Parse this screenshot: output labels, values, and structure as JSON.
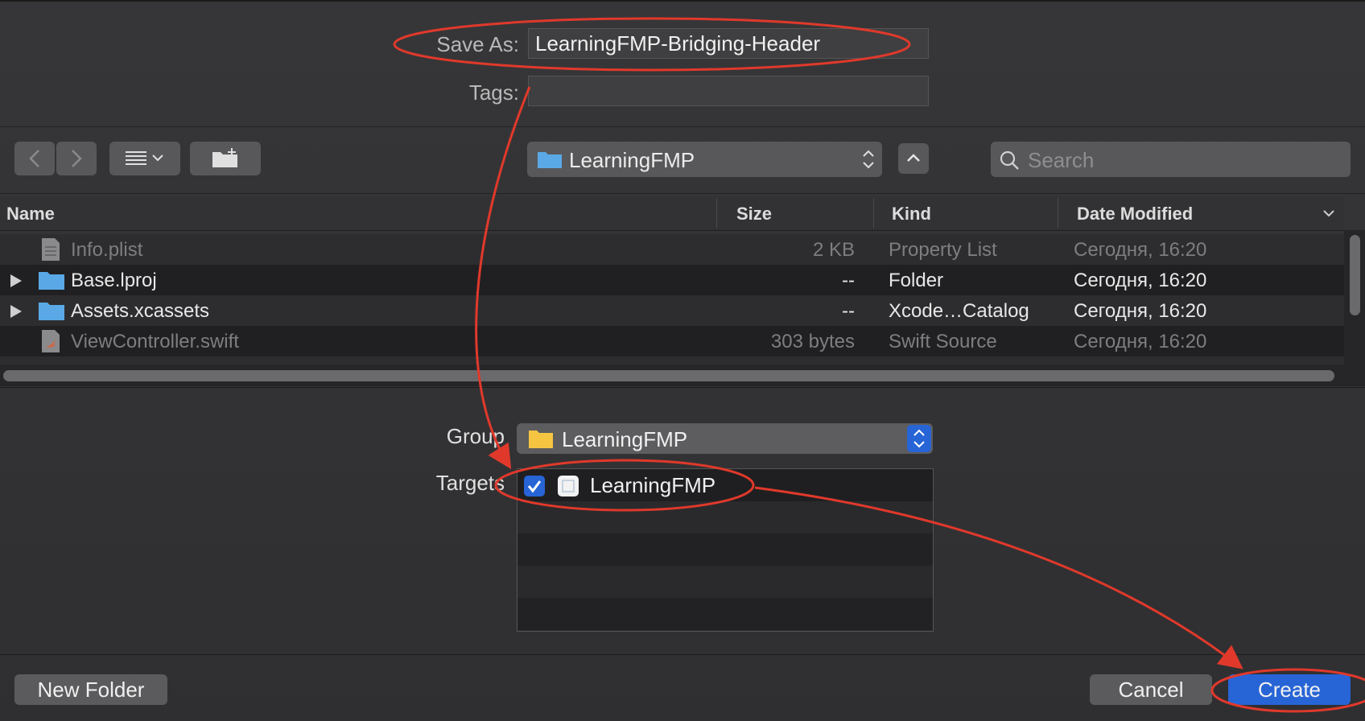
{
  "save_as": {
    "label": "Save As:",
    "value": "LearningFMP-Bridging-Header"
  },
  "tags": {
    "label": "Tags:",
    "value": ""
  },
  "toolbar": {
    "back_icon": "chevron-left-icon",
    "forward_icon": "chevron-right-icon",
    "view_icon": "list-view-icon",
    "new_folder_icon": "new-folder-icon",
    "location": "LearningFMP",
    "search_placeholder": "Search"
  },
  "file_list": {
    "columns": [
      "Name",
      "Size",
      "Kind",
      "Date Modified"
    ],
    "rows": [
      {
        "name": "Info.plist",
        "size": "2 KB",
        "kind": "Property List",
        "date": "Сегодня, 16:20",
        "icon": "plist-file-icon",
        "enabled": false,
        "expandable": false
      },
      {
        "name": "Base.lproj",
        "size": "--",
        "kind": "Folder",
        "date": "Сегодня, 16:20",
        "icon": "folder-icon",
        "enabled": true,
        "expandable": true
      },
      {
        "name": "Assets.xcassets",
        "size": "--",
        "kind": "Xcode…Catalog",
        "date": "Сегодня, 16:20",
        "icon": "folder-icon",
        "enabled": true,
        "expandable": true
      },
      {
        "name": "ViewController.swift",
        "size": "303 bytes",
        "kind": "Swift Source",
        "date": "Сегодня, 16:20",
        "icon": "swift-file-icon",
        "enabled": false,
        "expandable": false
      }
    ]
  },
  "group": {
    "label": "Group",
    "value": "LearningFMP"
  },
  "targets": {
    "label": "Targets",
    "items": [
      {
        "name": "LearningFMP",
        "checked": true
      }
    ]
  },
  "buttons": {
    "new_folder": "New Folder",
    "cancel": "Cancel",
    "create": "Create"
  },
  "colors": {
    "accent": "#2764d6",
    "annotation": "#e0392b",
    "folder_blue": "#5aa9e6",
    "folder_yellow": "#f5c542"
  }
}
